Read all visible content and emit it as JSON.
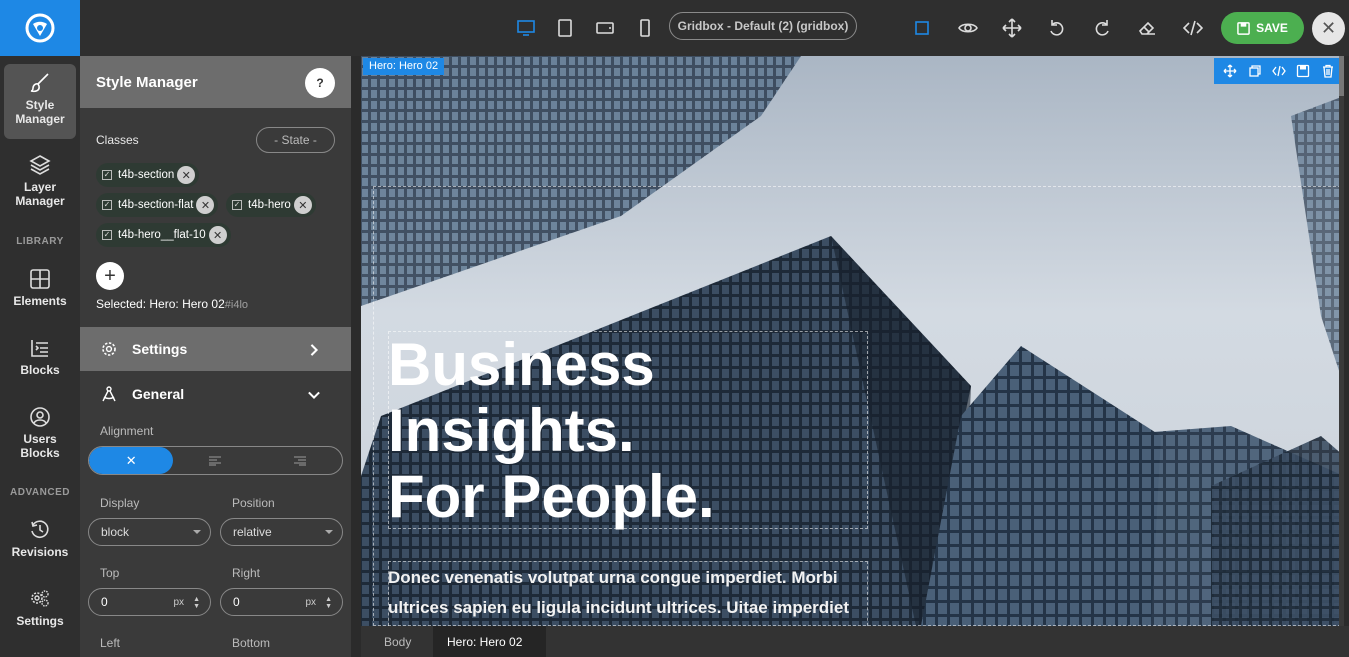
{
  "topbar": {
    "theme_label": "Gridbox - Default (2) (gridbox)",
    "save_label": "SAVE",
    "close_symbol": "✕",
    "devices": [
      "desktop-icon",
      "tablet-icon",
      "tablet-landscape-icon",
      "phone-icon"
    ],
    "actions": [
      "select-icon",
      "preview-icon",
      "move-icon",
      "undo-icon",
      "redo-icon",
      "eraser-icon",
      "code-icon"
    ]
  },
  "leftnav": {
    "items": [
      {
        "label": "Style Manager",
        "icon": "brush-icon"
      },
      {
        "label": "Layer Manager",
        "icon": "layers-icon"
      },
      {
        "label": "Elements",
        "icon": "grid-icon"
      },
      {
        "label": "Blocks",
        "icon": "blocks-icon"
      },
      {
        "label": "Users Blocks",
        "icon": "user-icon"
      },
      {
        "label": "Revisions",
        "icon": "history-icon"
      },
      {
        "label": "Settings",
        "icon": "gears-icon"
      }
    ],
    "sections": [
      "LIBRARY",
      "ADVANCED"
    ]
  },
  "panel": {
    "title": "Style Manager",
    "help": "?",
    "classes_label": "Classes",
    "state_label": "- State -",
    "tags": [
      "t4b-section",
      "t4b-section-flat",
      "t4b-hero",
      "t4b-hero__flat-10"
    ],
    "add_symbol": "+",
    "selected_prefix": "Selected:",
    "selected_name": "Hero: Hero 02",
    "selected_id": "#i4lo",
    "settings_label": "Settings",
    "general_label": "General",
    "alignment_label": "Alignment",
    "display_label": "Display",
    "display_value": "block",
    "position_label": "Position",
    "position_value": "relative",
    "top_label": "Top",
    "top_value": "0",
    "top_unit": "px",
    "right_label": "Right",
    "right_value": "0",
    "right_unit": "px",
    "left_label": "Left",
    "bottom_label": "Bottom"
  },
  "canvas": {
    "selected_label": "Hero: Hero 02",
    "headline": [
      "Business",
      "Insights.",
      "For People."
    ],
    "lead": "Donec venenatis volutpat urna congue imperdiet. Morbi ultrices sapien eu ligula incidunt ultrices. Uitae imperdiet"
  },
  "breadcrumb": [
    "Body",
    "Hero: Hero 02"
  ],
  "colors": {
    "accent": "#1e88e5",
    "save": "#4caf50",
    "topbar": "#2f2f2f",
    "panel": "#3a3a3a"
  }
}
